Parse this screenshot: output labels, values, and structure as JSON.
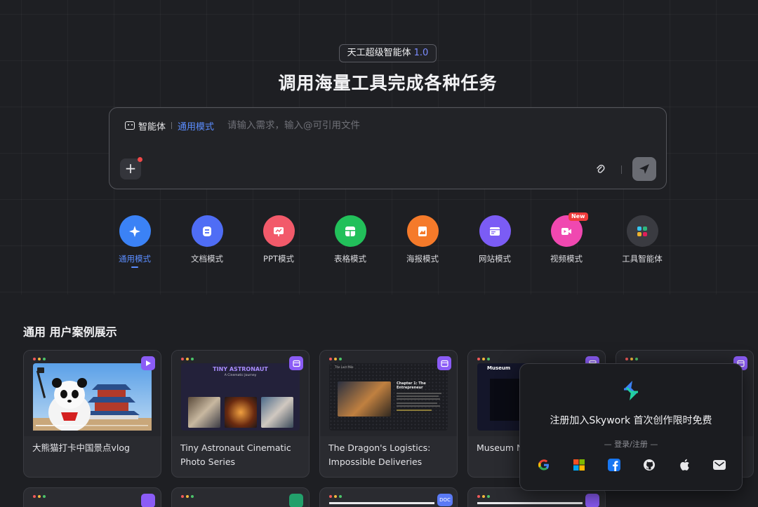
{
  "hero": {
    "badge_label": "天工超级智能体",
    "badge_version": "1.0",
    "title": "调用海量工具完成各种任务"
  },
  "input": {
    "agent_label": "智能体",
    "mode_label": "通用模式",
    "placeholder": "请输入需求，输入@可引用文件"
  },
  "modes": [
    {
      "label": "通用模式",
      "color": "#3b82f6",
      "icon": "sparkle-icon"
    },
    {
      "label": "文档模式",
      "color": "#4f6df5",
      "icon": "document-icon"
    },
    {
      "label": "PPT模式",
      "color": "#f25a6a",
      "icon": "presentation-icon"
    },
    {
      "label": "表格模式",
      "color": "#22c05a",
      "icon": "table-icon"
    },
    {
      "label": "海报模式",
      "color": "#f57a2a",
      "icon": "poster-icon"
    },
    {
      "label": "网站模式",
      "color": "#7b5cf5",
      "icon": "website-icon"
    },
    {
      "label": "视频模式",
      "color": "#f048b0",
      "icon": "video-icon",
      "badge": "New"
    },
    {
      "label": "工具智能体",
      "color": "#3a3b41",
      "icon": "tools-icon"
    }
  ],
  "section": {
    "title": "通用 用户案例展示"
  },
  "cards": [
    {
      "title": "大熊猫打卡中国景点vlog",
      "tag": "play-icon"
    },
    {
      "title": "Tiny Astronaut Cinematic Photo Series",
      "tag": "poster-icon",
      "thumb_title": "TINY ASTRONAUT",
      "thumb_sub": "A Cinematic Journey"
    },
    {
      "title": "The Dragon's Logistics: Impossible Deliveries",
      "tag": "poster-icon",
      "thumb_title": "Chapter 1: The Entrepreneur",
      "thumb_small": "The Last Mile"
    },
    {
      "title": "Museum Ni Vlog",
      "tag": "poster-icon",
      "thumb_title": "Museum"
    },
    {
      "title": "",
      "tag": "poster-icon"
    }
  ],
  "popup": {
    "title": "注册加入Skywork 首次创作限时免费",
    "subtitle": "— 登录/注册 —"
  },
  "bottom_card_tags": [
    "poster-icon",
    "poster-icon",
    "image-icon",
    "DOC",
    "poster-icon"
  ]
}
